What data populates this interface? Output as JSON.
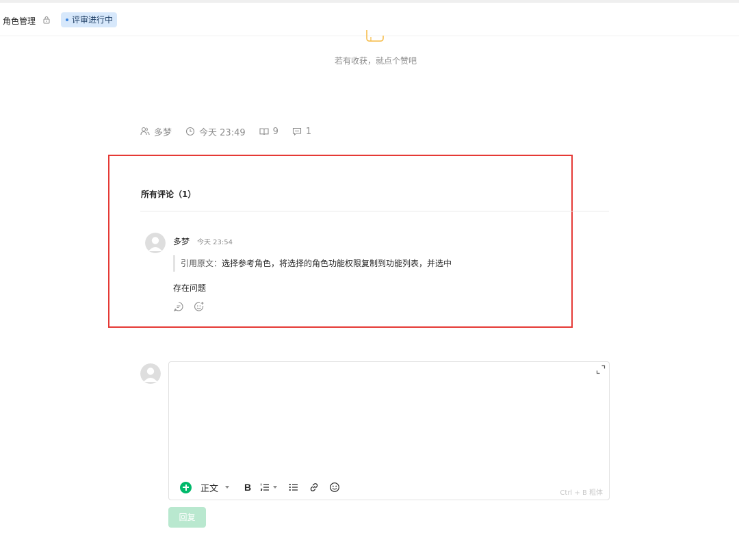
{
  "header": {
    "breadcrumb": "角色管理",
    "status_badge": "评审进行中",
    "status_color": "#3d86df"
  },
  "like": {
    "tip": "若有收获，就点个赞吧"
  },
  "meta": {
    "author": "多梦",
    "time": "今天 23:49",
    "reads": "9",
    "comments": "1"
  },
  "comments": {
    "title": "所有评论（1）",
    "items": [
      {
        "author": "多梦",
        "time": "今天 23:54",
        "quote_prefix": "引用原文：",
        "quote_text": "选择参考角色，将选择的角色功能权限复制到功能列表，并选中",
        "text": "存在问题"
      }
    ]
  },
  "editor": {
    "style_label": "正文",
    "bold_label": "B",
    "shortcut_hint": "Ctrl + B  粗体",
    "reply_label": "回复",
    "accent_color": "#00b96b"
  },
  "annotation_color": "#e53935"
}
